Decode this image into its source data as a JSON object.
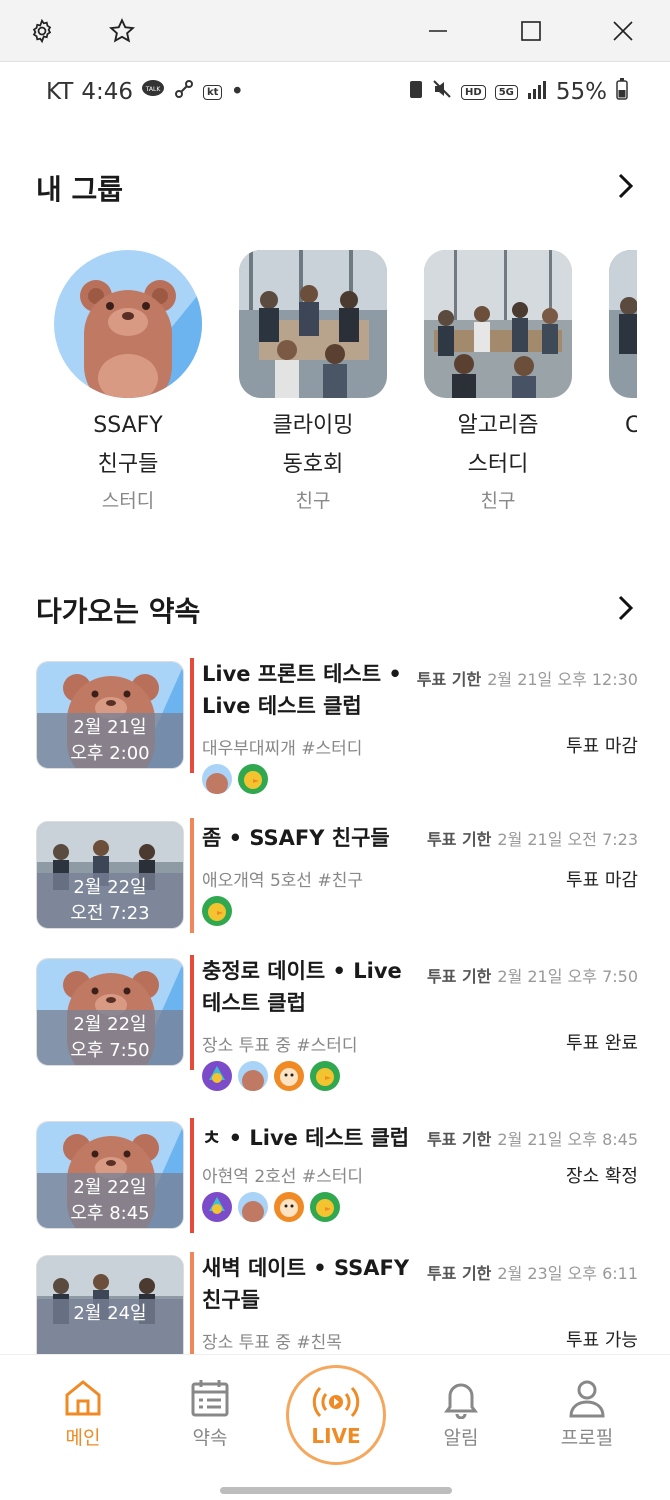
{
  "status_bar": {
    "carrier": "KT",
    "time": "4:46",
    "battery": "55%"
  },
  "groups_section": {
    "title": "내 그룹"
  },
  "groups": [
    {
      "name_line1": "SSAFY",
      "name_line2": "친구들",
      "type": "스터디"
    },
    {
      "name_line1": "클라이밍",
      "name_line2": "동호회",
      "type": "친구"
    },
    {
      "name_line1": "알고리즘",
      "name_line2": "스터디",
      "type": "친구"
    },
    {
      "name_line1": "C",
      "name_line2": "",
      "type": ""
    }
  ],
  "appointments_section": {
    "title": "다가오는 약속"
  },
  "appointments": [
    {
      "title": "Live 프론트 테스트 • Live 테스트 클럽",
      "sub": "대우부대찌개 #스터디",
      "date": "2월 21일",
      "time": "오후 2:00",
      "deadline_label": "투표 기한",
      "deadline": "2월 21일 오후 12:30",
      "status": "투표 마감",
      "bar_color": "#e64a3b"
    },
    {
      "title": "좀 • SSAFY 친구들",
      "sub": "애오개역 5호선 #친구",
      "date": "2월 22일",
      "time": "오전 7:23",
      "deadline_label": "투표 기한",
      "deadline": "2월 21일 오전 7:23",
      "status": "투표 마감",
      "bar_color": "#f0875a"
    },
    {
      "title": "충정로 데이트 • Live 테스트 클럽",
      "sub": "장소 투표 중 #스터디",
      "date": "2월 22일",
      "time": "오후 7:50",
      "deadline_label": "투표 기한",
      "deadline": "2월 21일 오후 7:50",
      "status": "투표 완료",
      "bar_color": "#e64a3b"
    },
    {
      "title": "ㅊ • Live 테스트 클럽",
      "sub": "아현역 2호선 #스터디",
      "date": "2월 22일",
      "time": "오후 8:45",
      "deadline_label": "투표 기한",
      "deadline": "2월 21일 오후 8:45",
      "status": "장소 확정",
      "bar_color": "#e64a3b"
    },
    {
      "title": "새벽 데이트 • SSAFY 친구들",
      "sub": "장소 투표 중 #친목",
      "date": "2월 24일",
      "time": "",
      "deadline_label": "투표 기한",
      "deadline": "2월 23일 오후 6:11",
      "status": "투표 가능",
      "bar_color": "#f0875a"
    }
  ],
  "nav": {
    "home": "메인",
    "appointments": "약속",
    "live": "LIVE",
    "alerts": "알림",
    "profile": "프로필"
  },
  "colors": {
    "accent": "#f08a24",
    "bar_red": "#e64a3b",
    "bar_orange": "#f0875a"
  }
}
